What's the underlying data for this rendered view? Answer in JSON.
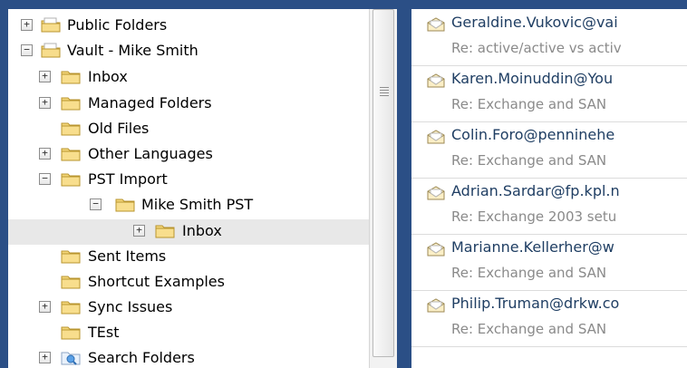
{
  "folder_tree": [
    {
      "label": "Public Folders",
      "expander": "+",
      "icon": "public-folders-icon",
      "level": 0
    },
    {
      "label": "Vault - Mike Smith",
      "expander": "−",
      "icon": "vault-icon",
      "level": 0
    },
    {
      "label": "Inbox",
      "expander": "+",
      "icon": "folder-icon",
      "level": 1
    },
    {
      "label": "Managed Folders",
      "expander": "+",
      "icon": "folder-icon",
      "level": 1
    },
    {
      "label": "Old Files",
      "expander": "",
      "icon": "folder-icon",
      "level": 1
    },
    {
      "label": "Other Languages",
      "expander": "+",
      "icon": "folder-icon",
      "level": 1
    },
    {
      "label": "PST Import",
      "expander": "−",
      "icon": "folder-icon",
      "level": 1
    },
    {
      "label": "Mike Smith PST",
      "expander": "−",
      "icon": "folder-icon",
      "level": 2
    },
    {
      "label": "Inbox",
      "expander": "+",
      "icon": "folder-icon",
      "level": 3,
      "selected": true
    },
    {
      "label": "Sent Items",
      "expander": "",
      "icon": "folder-icon",
      "level": 1
    },
    {
      "label": "Shortcut Examples",
      "expander": "",
      "icon": "folder-icon",
      "level": 1
    },
    {
      "label": "Sync Issues",
      "expander": "+",
      "icon": "folder-icon",
      "level": 1
    },
    {
      "label": "TEst",
      "expander": "",
      "icon": "folder-icon",
      "level": 1
    },
    {
      "label": "Search Folders",
      "expander": "+",
      "icon": "search-folder-icon",
      "level": 1
    }
  ],
  "messages": [
    {
      "sender": "Geraldine.Vukovic@vai",
      "subject": "Re: active/active vs activ",
      "icon": "envelope-open-icon"
    },
    {
      "sender": "Karen.Moinuddin@You",
      "subject": "Re: Exchange and SAN",
      "icon": "envelope-open-icon"
    },
    {
      "sender": "Colin.Foro@penninehe",
      "subject": "Re: Exchange and SAN",
      "icon": "envelope-open-icon"
    },
    {
      "sender": "Adrian.Sardar@fp.kpl.n",
      "subject": "Re: Exchange 2003 setu",
      "icon": "envelope-open-icon"
    },
    {
      "sender": "Marianne.Kellerher@w",
      "subject": "Re: Exchange and SAN",
      "icon": "envelope-open-icon"
    },
    {
      "sender": "Philip.Truman@drkw.co",
      "subject": "Re: Exchange and SAN",
      "icon": "envelope-open-icon"
    }
  ],
  "colors": {
    "frame": "#2b4f86",
    "selected_row": "#e8e8e8",
    "folder_yellow": "#f4d67a",
    "sender_text": "#1f3e63",
    "subject_text": "#8a8a8a"
  }
}
